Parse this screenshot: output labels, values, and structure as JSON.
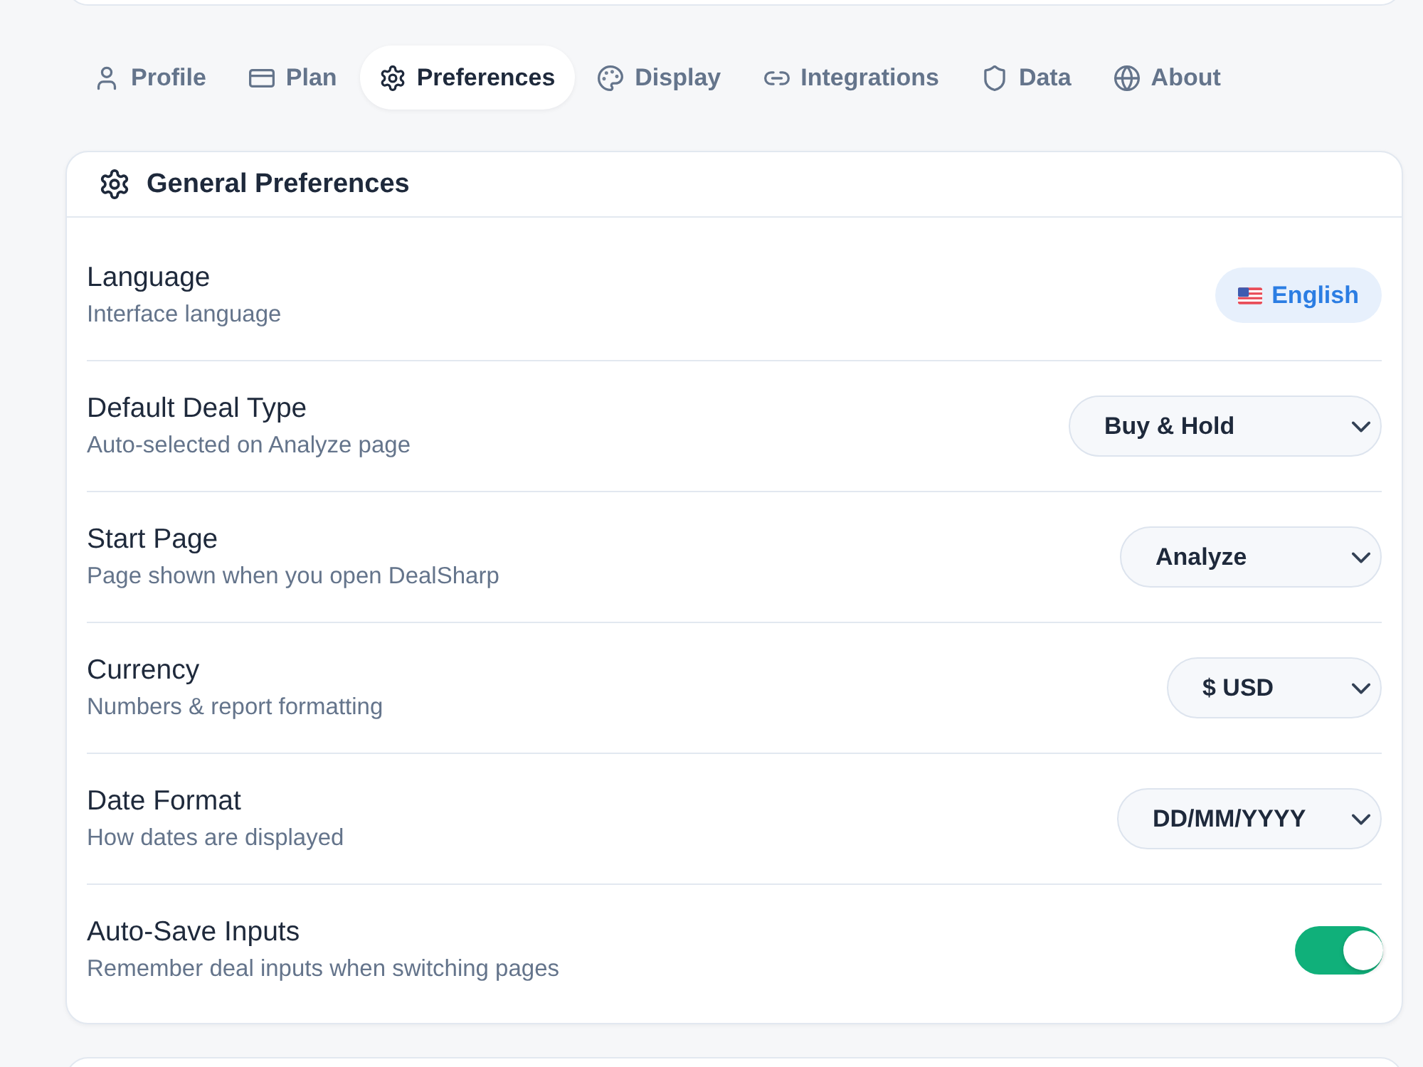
{
  "tabs": [
    {
      "label": "Profile",
      "selected": false
    },
    {
      "label": "Plan",
      "selected": false
    },
    {
      "label": "Preferences",
      "selected": true
    },
    {
      "label": "Display",
      "selected": false
    },
    {
      "label": "Integrations",
      "selected": false
    },
    {
      "label": "Data",
      "selected": false
    },
    {
      "label": "About",
      "selected": false
    }
  ],
  "panel": {
    "title": "General Preferences",
    "rows": [
      {
        "kind": "badge",
        "label": "Language",
        "description": "Interface language",
        "value": "English"
      },
      {
        "kind": "select",
        "label": "Default Deal Type",
        "description": "Auto-selected on Analyze page",
        "value": "Buy & Hold"
      },
      {
        "kind": "select",
        "label": "Start Page",
        "description": "Page shown when you open DealSharp",
        "value": "Analyze"
      },
      {
        "kind": "select",
        "label": "Currency",
        "description": "Numbers & report formatting",
        "value": "$ USD"
      },
      {
        "kind": "select",
        "label": "Date Format",
        "description": "How dates are displayed",
        "value": "DD/MM/YYYY"
      },
      {
        "kind": "toggle",
        "label": "Auto-Save Inputs",
        "description": "Remember deal inputs when switching pages",
        "on": true
      }
    ]
  }
}
